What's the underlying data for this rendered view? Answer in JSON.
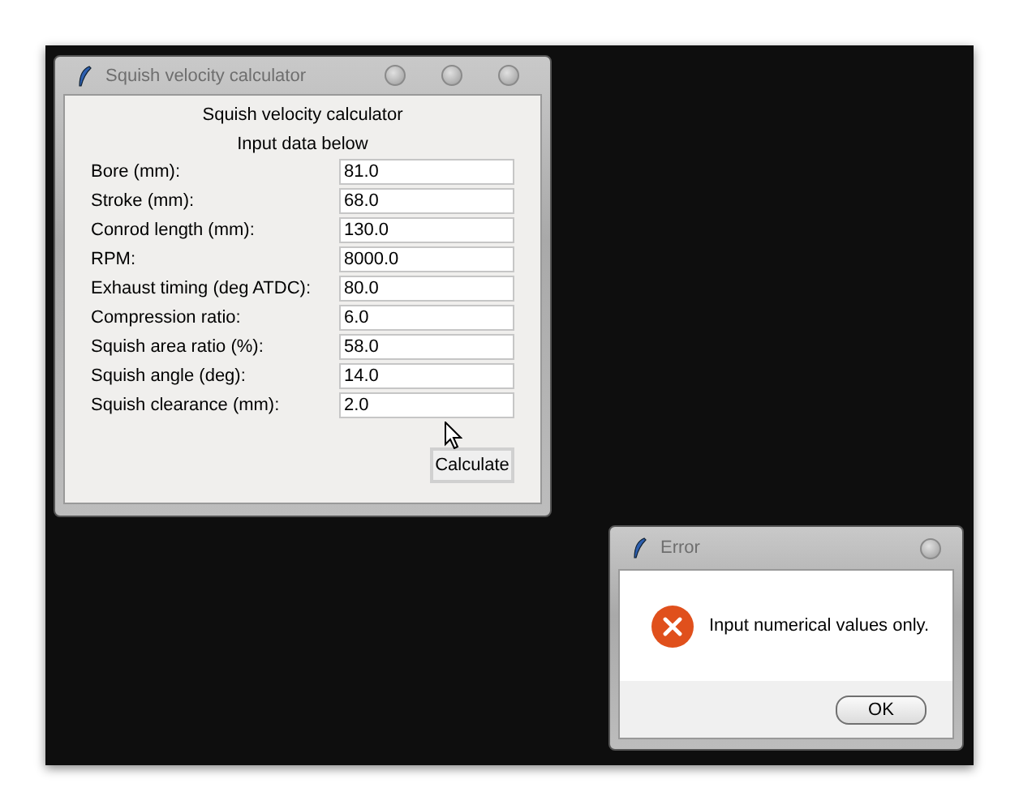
{
  "main_window": {
    "title": "Squish velocity calculator",
    "heading": "Squish velocity calculator",
    "subheading": "Input data below",
    "fields": [
      {
        "label": "Bore (mm):",
        "value": "81.0"
      },
      {
        "label": "Stroke (mm):",
        "value": "68.0"
      },
      {
        "label": "Conrod length (mm):",
        "value": "130.0"
      },
      {
        "label": "RPM:",
        "value": "8000.0"
      },
      {
        "label": "Exhaust timing (deg ATDC):",
        "value": "80.0"
      },
      {
        "label": "Compression ratio:",
        "value": "6.0"
      },
      {
        "label": "Squish area ratio (%):",
        "value": "58.0"
      },
      {
        "label": "Squish angle (deg):",
        "value": "14.0"
      },
      {
        "label": "Squish clearance (mm):",
        "value": "2.0"
      }
    ],
    "button": "Calculate"
  },
  "error_dialog": {
    "title": "Error",
    "message": "Input numerical values only.",
    "button": "OK"
  }
}
